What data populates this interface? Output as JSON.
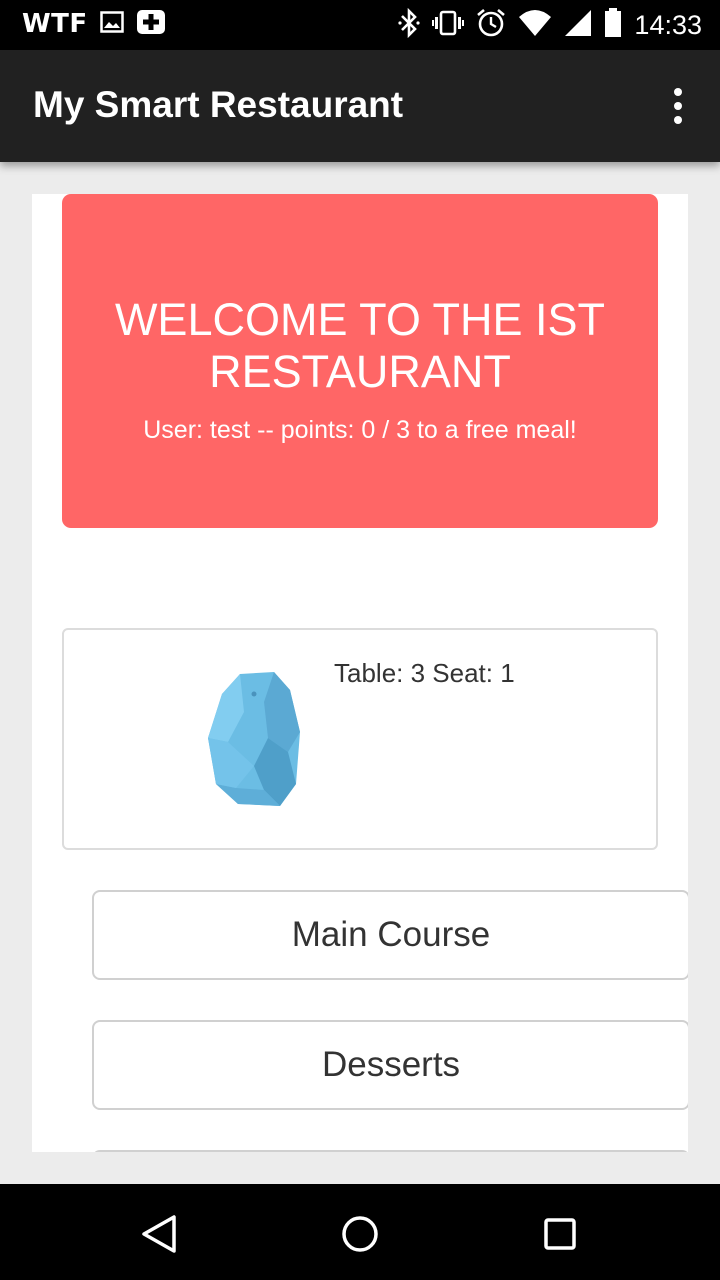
{
  "status_bar": {
    "carrier": "WTF",
    "time": "14:33",
    "icons": [
      "image-icon",
      "plus-icon",
      "bluetooth-icon",
      "vibrate-icon",
      "alarm-icon",
      "wifi-icon",
      "signal-icon",
      "battery-icon"
    ]
  },
  "app_bar": {
    "title": "My Smart Restaurant",
    "menu_icon": "overflow-menu-icon"
  },
  "welcome": {
    "title": "WELCOME TO THE IST RESTAURANT",
    "subtitle": "User: test -- points: 0 / 3 to a free meal!"
  },
  "table_card": {
    "beacon_icon": "beacon-icon",
    "label": "Table: 3 Seat: 1"
  },
  "menu": {
    "buttons": [
      {
        "label": "Main Course"
      },
      {
        "label": "Desserts"
      }
    ]
  },
  "nav_bar": {
    "icons": [
      "back-icon",
      "home-icon",
      "recents-icon"
    ]
  },
  "colors": {
    "welcome_bg": "#ff6666",
    "app_bar_bg": "#212121",
    "beacon": "#6bbde4"
  }
}
